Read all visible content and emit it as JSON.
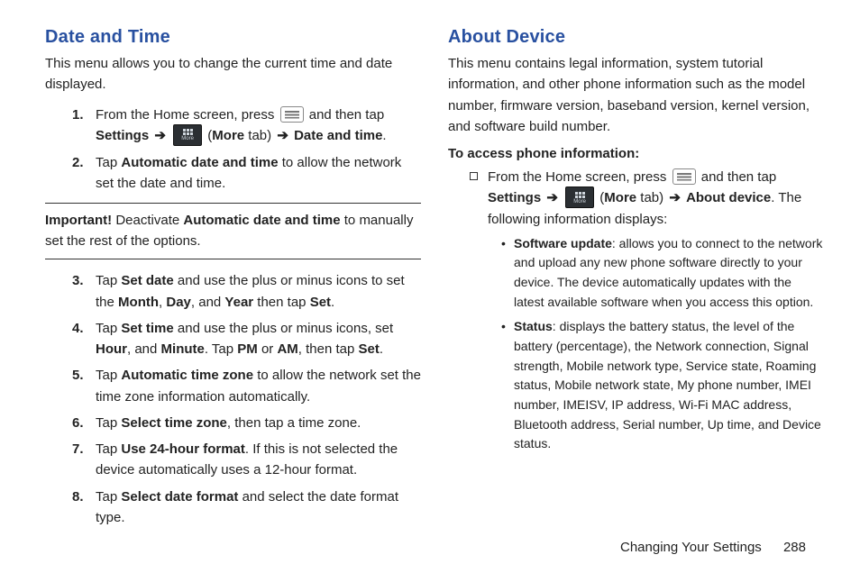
{
  "left": {
    "heading": "Date and Time",
    "intro": "This menu allows you to change the current time and date displayed.",
    "step1_a": "From the Home screen, press ",
    "step1_b": " and then tap ",
    "step1_c": "Settings",
    "step1_d": "More",
    "step1_e": " tab) ",
    "step1_f": "Date and time",
    "step2_a": "Tap ",
    "step2_b": "Automatic date and time",
    "step2_c": " to allow the network set the date and time.",
    "important_label": "Important!",
    "important_a": " Deactivate ",
    "important_b": "Automatic date and time",
    "important_c": " to manually set the rest of the options.",
    "step3_a": "Tap ",
    "step3_b": "Set date",
    "step3_c": " and use the plus or minus icons to set the ",
    "step3_d": "Month",
    "step3_e": ", ",
    "step3_f": "Day",
    "step3_g": ", and ",
    "step3_h": "Year",
    "step3_i": " then tap ",
    "step3_j": "Set",
    "step3_k": ".",
    "step4_a": "Tap ",
    "step4_b": "Set time",
    "step4_c": " and use the plus or minus icons, set ",
    "step4_d": "Hour",
    "step4_e": ", and ",
    "step4_f": "Minute",
    "step4_g": ". Tap ",
    "step4_h": "PM",
    "step4_i": " or ",
    "step4_j": "AM",
    "step4_k": ", then tap ",
    "step4_l": "Set",
    "step4_m": ".",
    "step5_a": "Tap ",
    "step5_b": "Automatic time zone",
    "step5_c": " to allow the network set the time zone information automatically.",
    "step6_a": "Tap ",
    "step6_b": "Select time zone",
    "step6_c": ", then tap a time zone.",
    "step7_a": "Tap ",
    "step7_b": "Use 24-hour format",
    "step7_c": ". If this is not selected the device automatically uses a 12-hour format.",
    "step8_a": "Tap ",
    "step8_b": "Select date format",
    "step8_c": " and select the date format type."
  },
  "right": {
    "heading": "About Device",
    "intro": "This menu contains legal information, system tutorial information, and other phone information such as the model number, firmware version, baseband version, kernel version, and software build number.",
    "subhead": "To access phone information:",
    "sq1_a": "From the Home screen, press ",
    "sq1_b": " and then tap ",
    "sq1_c": "Settings",
    "sq1_d": "More",
    "sq1_e": " tab) ",
    "sq1_f": "About device",
    "sq1_g": ". The following information displays:",
    "b1_label": "Software update",
    "b1_text": ": allows you to connect to the network and upload any new phone software directly to your device. The device automatically updates with the latest available software when you access this option.",
    "b2_label": "Status",
    "b2_text": ": displays the battery status, the level of the battery (percentage), the Network connection, Signal strength, Mobile network type, Service state, Roaming status, Mobile network state, My phone number, IMEI number, IMEISV, IP address, Wi-Fi MAC address, Bluetooth address, Serial number, Up time, and Device status."
  },
  "footer": {
    "section": "Changing Your Settings",
    "page": "288"
  },
  "icons": {
    "more_label": "More"
  }
}
